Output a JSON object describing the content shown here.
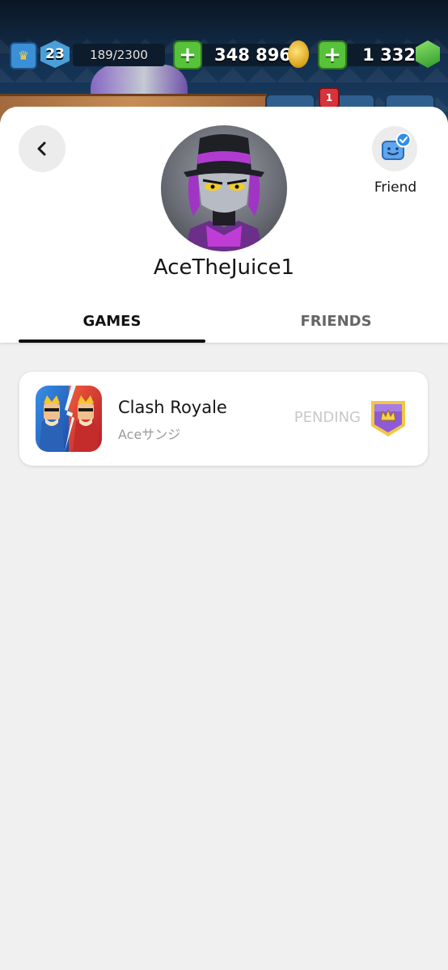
{
  "hud": {
    "level": "23",
    "xp": "189/2300",
    "gold": "348 896",
    "gems": "1 332",
    "notification_count": "1"
  },
  "profile": {
    "username": "AceTheJuice1",
    "friend_label": "Friend"
  },
  "tabs": [
    {
      "label": "GAMES",
      "active": true
    },
    {
      "label": "FRIENDS",
      "active": false
    }
  ],
  "games": [
    {
      "title": "Clash Royale",
      "player_name": "Aceサンジ",
      "status": "PENDING"
    }
  ],
  "colors": {
    "background": "#f0f0f0",
    "sheet": "#ffffff",
    "active_tab": "#111111",
    "inactive_tab": "#666666",
    "pending": "#c9c9c9",
    "friend_check": "#2f8ee8"
  },
  "icons": {
    "back": "chevron-left-icon",
    "friend": "friend-check-icon",
    "badge": "crown-shield-icon"
  }
}
